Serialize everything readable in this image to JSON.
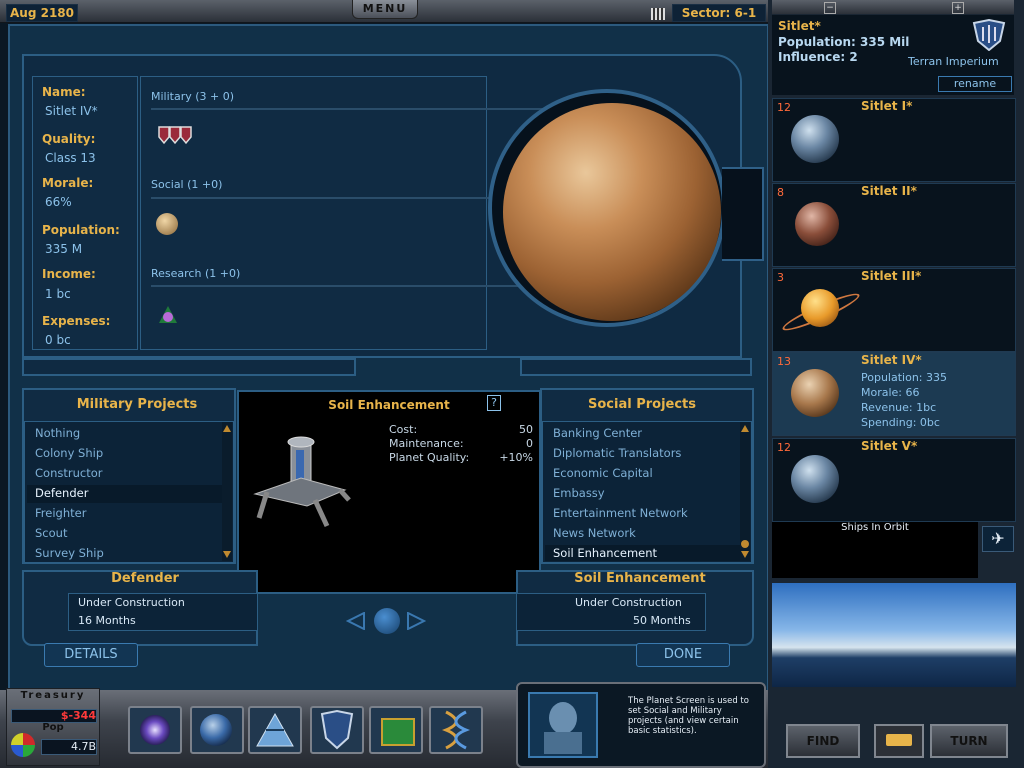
{
  "topbar": {
    "date": "Aug 2180",
    "menu_label": "MENU",
    "sector": "Sector: 6-1"
  },
  "planet": {
    "labels": {
      "name": "Name:",
      "quality": "Quality:",
      "morale": "Morale:",
      "population": "Population:",
      "income": "Income:",
      "expenses": "Expenses:"
    },
    "name": "Sitlet IV*",
    "quality": "Class 13",
    "morale": "66%",
    "population": "335 M",
    "income": "1 bc",
    "expenses": "0 bc"
  },
  "categories": {
    "military": "Military  (3 + 0)",
    "social": "Social  (1 +0)",
    "research": "Research  (1 +0)"
  },
  "military_projects": {
    "title": "Military Projects",
    "items": [
      "Nothing",
      "Colony Ship",
      "Constructor",
      "Defender",
      "Freighter",
      "Scout",
      "Survey Ship"
    ],
    "selected": "Defender"
  },
  "social_projects": {
    "title": "Social Projects",
    "items": [
      "Banking Center",
      "Diplomatic Translators",
      "Economic Capital",
      "Embassy",
      "Entertainment Network",
      "News Network",
      "Soil Enhancement"
    ],
    "selected": "Soil Enhancement"
  },
  "detail": {
    "title": "Soil Enhancement",
    "help": "?",
    "rows": [
      {
        "label": "Cost:",
        "value": "50"
      },
      {
        "label": "Maintenance:",
        "value": "0"
      },
      {
        "label": "Planet Quality:",
        "value": "+10%"
      }
    ]
  },
  "military_status": {
    "title": "Defender",
    "line1": "Under  Construction",
    "line2": "16  Months"
  },
  "social_status": {
    "title": "Soil Enhancement",
    "line1": "Under  Construction",
    "line2": "50  Months"
  },
  "buttons": {
    "details": "DETAILS",
    "done": "DONE"
  },
  "system": {
    "name": "Sitlet*",
    "population": "Population: 335 Mil",
    "influence": "Influence: 2",
    "faction": "Terran  Imperium",
    "rename": "rename"
  },
  "planets": [
    {
      "num": "12",
      "name": "Sitlet I*"
    },
    {
      "num": "8",
      "name": "Sitlet II*"
    },
    {
      "num": "3",
      "name": "Sitlet III*"
    },
    {
      "num": "13",
      "name": "Sitlet IV*",
      "population": "Population: 335",
      "morale": "Morale: 66",
      "revenue": "Revenue: 1bc",
      "spending": "Spending: 0bc"
    },
    {
      "num": "12",
      "name": "Sitlet V*"
    }
  ],
  "orbit_label": "Ships  In  Orbit",
  "treasury": {
    "label": "Treasury",
    "value": "$-344",
    "pop_label": "Pop",
    "pop_value": "4.7B"
  },
  "help_text": "The Planet Screen is used to set Social and Military projects (and view certain basic statistics).",
  "right_buttons": {
    "find": "FIND",
    "turn": "TURN"
  },
  "colors": {
    "gold": "#e8b44a",
    "blue": "#8cc2ea",
    "red": "#ff6a3a"
  }
}
